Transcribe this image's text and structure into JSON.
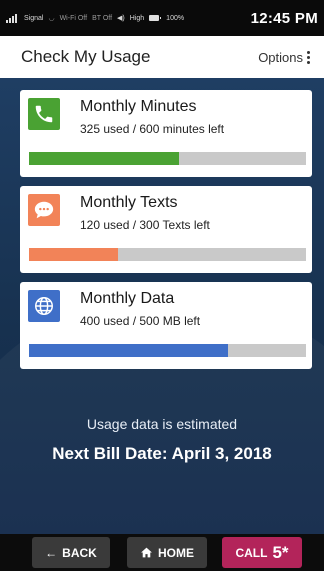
{
  "status_bar": {
    "signal_label": "Signal",
    "wifi_label": "Wi-Fi Off",
    "bt_label": "BT Off",
    "volume_label": "High",
    "battery_label": "100%",
    "time": "12:45 PM"
  },
  "app_bar": {
    "title": "Check My Usage",
    "options_label": "Options"
  },
  "usage": [
    {
      "title": "Monthly Minutes",
      "detail": "325 used / 600 minutes left",
      "icon": "phone-icon",
      "color": "#4aa233",
      "progress_fraction": 0.54
    },
    {
      "title": "Monthly Texts",
      "detail": "120 used / 300 Texts left",
      "icon": "chat-bubble-icon",
      "color": "#f28358",
      "progress_fraction": 0.32
    },
    {
      "title": "Monthly Data",
      "detail": "400 used / 500 MB left",
      "icon": "globe-icon",
      "color": "#3f6fc8",
      "progress_fraction": 0.72
    }
  ],
  "footer_notes": {
    "estimate": "Usage data is estimated",
    "bill_date": "Next Bill Date: April 3, 2018"
  },
  "bottom_nav": {
    "back_label": "BACK",
    "home_label": "HOME",
    "call_label": "CALL",
    "call_number": "5*"
  }
}
